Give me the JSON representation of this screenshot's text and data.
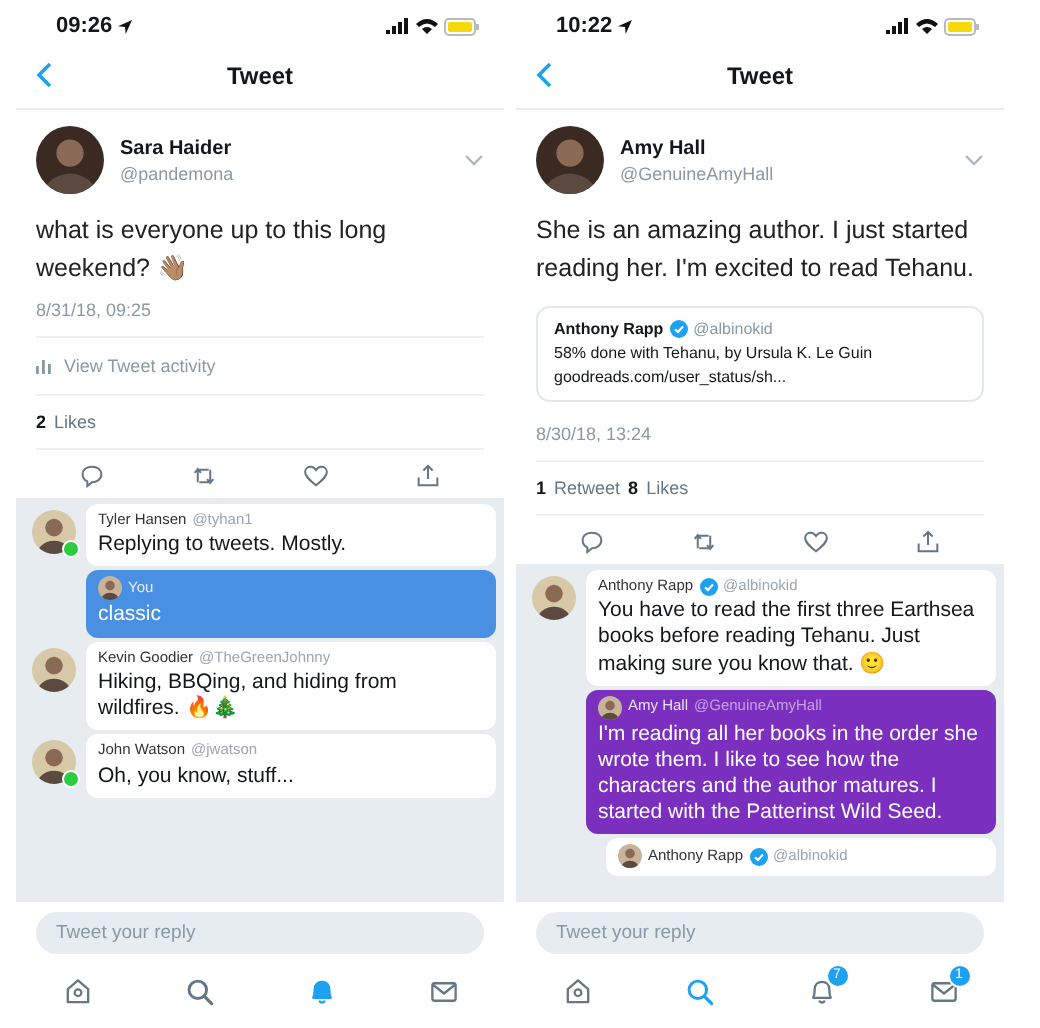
{
  "phones": [
    {
      "status_time": "09:26",
      "nav_title": "Tweet",
      "tweet": {
        "name": "Sara Haider",
        "handle": "@pandemona",
        "text": "what is everyone up to this long weekend? 👋🏽",
        "timestamp": "8/31/18, 09:25",
        "activity_link": "View Tweet activity",
        "stats": [
          {
            "count": "2",
            "label": "Likes"
          }
        ]
      },
      "replies": [
        {
          "name": "Tyler Hansen",
          "handle": "@tyhan1",
          "text": "Replying to tweets. Mostly.",
          "verified": false,
          "online": true,
          "color": "#ffffff",
          "children": [
            {
              "name": "You",
              "text": "classic",
              "verified": false,
              "color": "#4a90e2"
            }
          ]
        },
        {
          "name": "Kevin Goodier",
          "handle": "@TheGreenJohnny",
          "text": "Hiking, BBQing, and hiding from wildfires. 🔥🎄",
          "verified": false,
          "online": false,
          "color": "#ffffff"
        },
        {
          "name": "John Watson",
          "handle": "@jwatson",
          "text": "Oh, you know, stuff...",
          "verified": false,
          "online": true,
          "color": "#ffffff"
        }
      ],
      "reply_placeholder": "Tweet your reply",
      "tabs": [
        {
          "selected": false
        },
        {
          "selected": false
        },
        {
          "selected": true
        },
        {
          "selected": false
        }
      ]
    },
    {
      "status_time": "10:22",
      "nav_title": "Tweet",
      "tweet": {
        "name": "Amy Hall",
        "handle": "@GenuineAmyHall",
        "text": "She is an amazing author. I just started reading her.  I'm excited to read Tehanu.",
        "timestamp": "8/30/18, 13:24",
        "quote": {
          "name": "Anthony Rapp",
          "handle": "@albinokid",
          "verified": true,
          "text": "58% done with Tehanu, by Ursula K. Le Guin",
          "link": "goodreads.com/user_status/sh..."
        },
        "stats": [
          {
            "count": "1",
            "label": "Retweet"
          },
          {
            "count": "8",
            "label": "Likes"
          }
        ]
      },
      "replies": [
        {
          "name": "Anthony Rapp",
          "handle": "@albinokid",
          "text": "You have to read the first three Earthsea books before reading Tehanu. Just making sure you know that. 🙂",
          "verified": true,
          "online": false,
          "color": "#ffffff",
          "children": [
            {
              "name": "Amy Hall",
              "handle": "@GenuineAmyHall",
              "text": "I'm reading all her books in the order she wrote them.  I like to see how the characters and the author matures.  I started with the Patterinst Wild Seed.",
              "verified": false,
              "color": "#7b2fbe",
              "children": [
                {
                  "name": "Anthony Rapp",
                  "handle": "@albinokid",
                  "verified": true,
                  "color": "#ffffff"
                }
              ]
            }
          ]
        }
      ],
      "reply_placeholder": "Tweet your reply",
      "tabs": [
        {
          "selected": false
        },
        {
          "selected": true
        },
        {
          "selected": false,
          "badge": "7"
        },
        {
          "selected": false,
          "badge": "1"
        }
      ]
    }
  ]
}
